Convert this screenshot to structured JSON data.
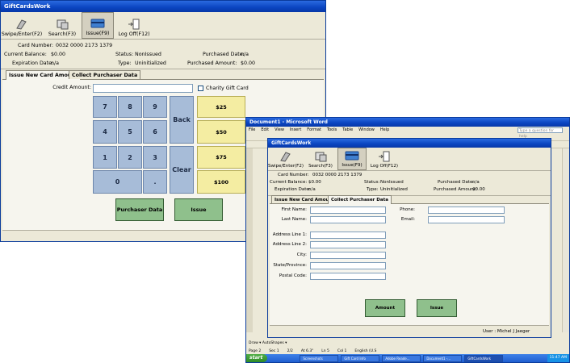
{
  "app_title": "GiftCardsWork",
  "toolbar": {
    "swipe": "Swipe/Enter(F2)",
    "search": "Search(F3)",
    "issue": "Issue(F9)",
    "logoff": "Log Off(F12)"
  },
  "info": {
    "card_number_label": "Card Number:",
    "card_number": "0032 0000 2173 1379",
    "balance_label": "Current Balance:",
    "balance": "$0.00",
    "expiration_label": "Expiration Date:",
    "expiration": "n/a",
    "status_label": "Status:",
    "status": "NonIssued",
    "type_label": "Type:",
    "type": "Uninitialized",
    "purchased_date_label": "Purchased Date:",
    "purchased_date": "n/a",
    "purchased_amount_label": "Purchased Amount:",
    "purchased_amount": "$0.00"
  },
  "tabs": {
    "issue": "Issue New Card Amount",
    "collect": "Collect Purchaser Data"
  },
  "issue_form": {
    "credit_amount_label": "Credit Amount:",
    "charity_label": "Charity Gift Card",
    "keys": [
      "7",
      "8",
      "9",
      "4",
      "5",
      "6",
      "1",
      "2",
      "3",
      "0",
      "."
    ],
    "back": "Back",
    "clear": "Clear",
    "amounts": [
      "$25",
      "$50",
      "$75",
      "$100"
    ],
    "purchaser_button": "Purchaser Data",
    "issue_button": "Issue"
  },
  "purchaser_form": {
    "first_name": "First Name:",
    "last_name": "Last Name:",
    "phone": "Phone:",
    "email": "Email:",
    "address1": "Address Line 1:",
    "address2": "Address Line 2:",
    "city": "City:",
    "state": "State/Province:",
    "postal": "Postal Code:",
    "amount_button": "Amount",
    "issue_button": "Issue",
    "user": "User : Michel J Jaeger"
  },
  "word": {
    "title": "Document1 - Microsoft Word",
    "menus": [
      "File",
      "Edit",
      "View",
      "Insert",
      "Format",
      "Tools",
      "Table",
      "Window",
      "Help"
    ],
    "help_placeholder": "Type a question for help",
    "drawbar": "Draw ▾   AutoShapes ▾",
    "status": [
      "Page 2",
      "Sec 1",
      "2/2",
      "At 6.3\"",
      "Ln 5",
      "Col 1",
      "English (U.S"
    ],
    "start": "start",
    "tasks": [
      "Screenshots",
      "Gift Card Info",
      "Adobe Reade...",
      "Document1 -...",
      "GiftCardsWork"
    ],
    "clock": "11:47 AM"
  }
}
